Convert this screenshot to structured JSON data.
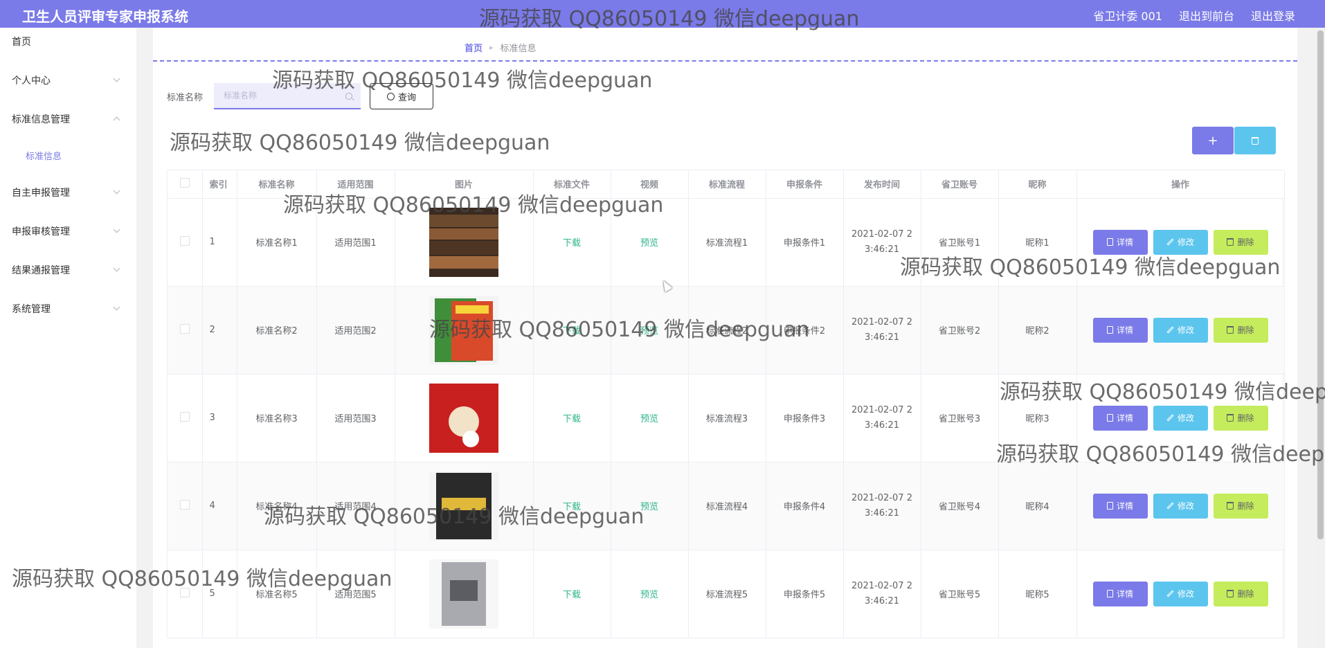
{
  "header": {
    "app_title": "卫生人员评审专家申报系统",
    "user": "省卫计委 001",
    "to_front": "退出到前台",
    "logout": "退出登录"
  },
  "sidebar": {
    "items": [
      {
        "label": "首页"
      },
      {
        "label": "个人中心"
      },
      {
        "label": "标准信息管理"
      },
      {
        "label": "标准信息"
      },
      {
        "label": "自主申报管理"
      },
      {
        "label": "申报审核管理"
      },
      {
        "label": "结果通报管理"
      },
      {
        "label": "系统管理"
      }
    ]
  },
  "breadcrumb": {
    "home": "首页",
    "current": "标准信息"
  },
  "search": {
    "label": "标准名称",
    "placeholder": "标准名称",
    "value": "",
    "query_label": "查询"
  },
  "toolbar": {
    "add_label": "+"
  },
  "table": {
    "headers": [
      "索引",
      "标准名称",
      "适用范围",
      "图片",
      "标准文件",
      "视频",
      "标准流程",
      "申报条件",
      "发布时间",
      "省卫账号",
      "昵称",
      "操作"
    ],
    "rows": [
      {
        "index": "1",
        "name": "标准名称1",
        "scope": "适用范围1",
        "file": "下载",
        "video": "预览",
        "flow": "标准流程1",
        "cond": "申报条件1",
        "time": "2021-02-07 23:46:21",
        "account": "省卫账号1",
        "nick": "昵称1"
      },
      {
        "index": "2",
        "name": "标准名称2",
        "scope": "适用范围2",
        "file": "下载",
        "video": "预览",
        "flow": "标准流程2",
        "cond": "申报条件2",
        "time": "2021-02-07 23:46:21",
        "account": "省卫账号2",
        "nick": "昵称2"
      },
      {
        "index": "3",
        "name": "标准名称3",
        "scope": "适用范围3",
        "file": "下载",
        "video": "预览",
        "flow": "标准流程3",
        "cond": "申报条件3",
        "time": "2021-02-07 23:46:21",
        "account": "省卫账号3",
        "nick": "昵称3"
      },
      {
        "index": "4",
        "name": "标准名称4",
        "scope": "适用范围4",
        "file": "下载",
        "video": "预览",
        "flow": "标准流程4",
        "cond": "申报条件4",
        "time": "2021-02-07 23:46:21",
        "account": "省卫账号4",
        "nick": "昵称4"
      },
      {
        "index": "5",
        "name": "标准名称5",
        "scope": "适用范围5",
        "file": "下载",
        "video": "预览",
        "flow": "标准流程5",
        "cond": "申报条件5",
        "time": "2021-02-07 23:46:21",
        "account": "省卫账号5",
        "nick": "昵称5"
      }
    ],
    "actions": {
      "detail": "详情",
      "edit": "修改",
      "delete": "删除"
    }
  },
  "watermark": {
    "text": "源码获取 QQ86050149 微信deepguan"
  },
  "colors": {
    "primary": "#7a7ae8",
    "info": "#5cc5ee",
    "warn": "#c4ec5c",
    "link": "#2fb48c"
  }
}
